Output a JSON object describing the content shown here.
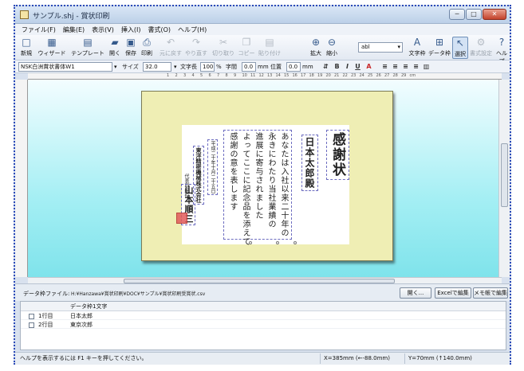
{
  "window": {
    "title": "サンプル.shj - 賞状印刷",
    "buttons": [
      "─",
      "□",
      "✕"
    ]
  },
  "menu": [
    "ファイル(F)",
    "編集(E)",
    "表示(V)",
    "挿入(I)",
    "書式(O)",
    "ヘルプ(H)"
  ],
  "toolbar": {
    "items": [
      {
        "label": "新規",
        "icon": "□"
      },
      {
        "label": "ウィザード",
        "icon": "▦"
      },
      {
        "label": "テンプレート",
        "icon": "▤"
      },
      {
        "label": "開く",
        "icon": "▰"
      },
      {
        "label": "保存",
        "icon": "▣"
      },
      {
        "label": "印刷",
        "icon": "⎙"
      },
      {
        "label": "元に戻す",
        "icon": "↶"
      },
      {
        "label": "やり直す",
        "icon": "↷"
      },
      {
        "label": "切り取り",
        "icon": "✂"
      },
      {
        "label": "コピー",
        "icon": "❐"
      },
      {
        "label": "貼り付け",
        "icon": "▤"
      },
      {
        "label": "拡大",
        "icon": "⊕"
      },
      {
        "label": "縮小",
        "icon": "⊖"
      },
      {
        "label": "文字枠",
        "icon": "A"
      },
      {
        "label": "データ枠",
        "icon": "⊞"
      },
      {
        "label": "選択",
        "icon": "↖"
      },
      {
        "label": "書式設定",
        "icon": "⚙"
      },
      {
        "label": "ヘルプ",
        "icon": "?"
      }
    ],
    "font_box": "abl"
  },
  "format": {
    "font_name": "NSK白洲賞状書体W1",
    "size_label": "サイズ",
    "size_value": "32.0",
    "width_label": "文字長",
    "width_value": "100",
    "width_unit": "%",
    "pitch_label": "字間",
    "pitch_value": "0.0",
    "pitch_unit": "mm",
    "pos_label": "位置",
    "pos_value": "0.0",
    "pos_unit": "mm",
    "icons": [
      "B",
      "I",
      "U",
      "A",
      "≡",
      "≡",
      "≡",
      "≡",
      "▥"
    ]
  },
  "ruler": {
    "ticks": [
      "1",
      "2",
      "3",
      "4",
      "5",
      "6",
      "7",
      "8",
      "9",
      "10",
      "11",
      "12",
      "13",
      "14",
      "15",
      "16",
      "17",
      "18",
      "19",
      "20",
      "21",
      "22",
      "23",
      "24",
      "25",
      "26",
      "27",
      "28",
      "29",
      "cm"
    ]
  },
  "certificate": {
    "title": "感謝状",
    "recipient": "日本太郎殿",
    "body_lines": [
      "あなたは入社以来二十年の",
      "永きにわたり当社業績の",
      "進展に寄与されました",
      "よってここに記念品を添えて",
      "感謝の意を表します"
    ],
    "date": "平成二十年十月二十五日",
    "company": "東洋精密機械株式会社",
    "presenter_title": "代表取締役",
    "presenter_name": "山本順三"
  },
  "datafile": {
    "label": "データ枠ファイル:",
    "path": "H:¥Hanzawa¥賞状印刷¥DOC¥サンプル¥賞状印刷受賞状.csv",
    "open_button": "開く...",
    "excel_button": "Excelで編集",
    "notepad_button": "メモ帳で編集"
  },
  "datalist": {
    "header": "データ枠1文字",
    "rows": [
      {
        "no": "1行目",
        "value": "日本太郎"
      },
      {
        "no": "2行目",
        "value": "東京次郎"
      }
    ]
  },
  "status": {
    "help": "ヘルプを表示するには F1 キーを押してください。",
    "x": "X=385mm (←-88.0mm)",
    "y": "Y=70mm (↑140.0mm)"
  }
}
